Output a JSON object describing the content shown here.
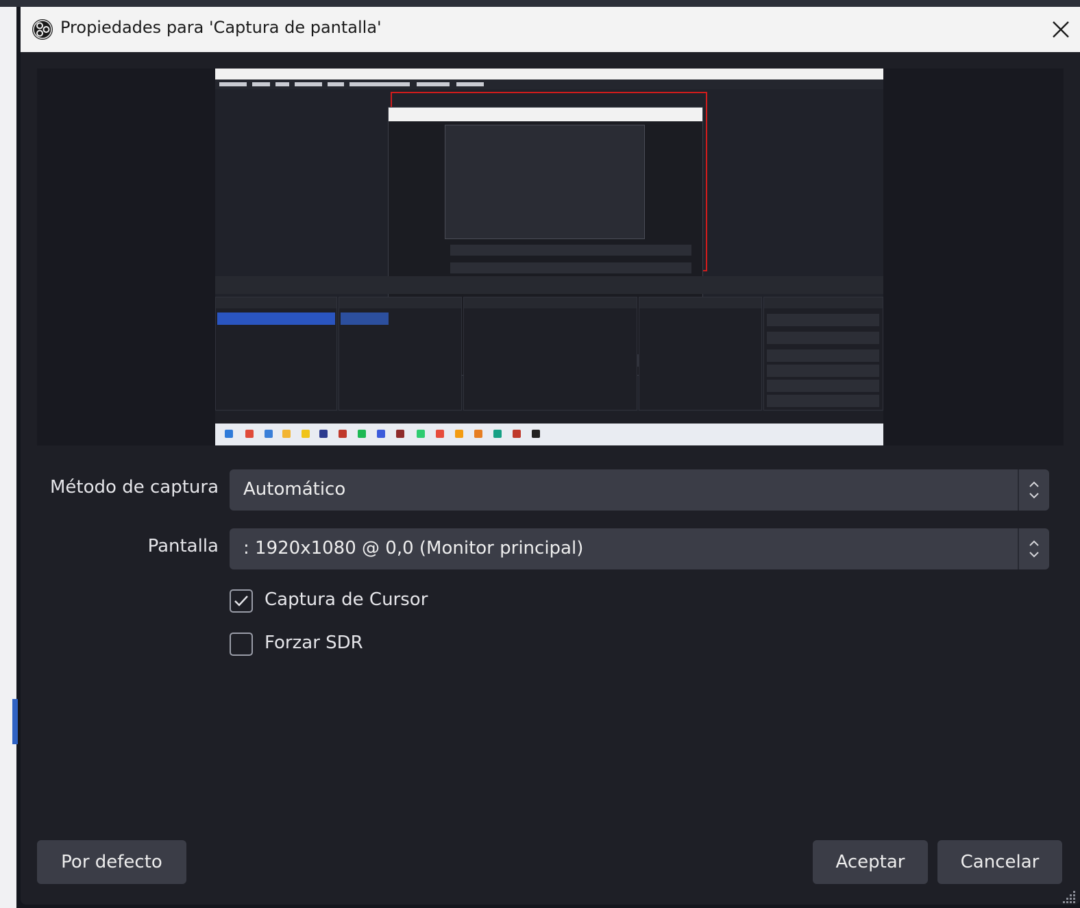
{
  "dialog": {
    "title": "Propiedades para 'Captura de pantalla'"
  },
  "form": {
    "capture_method": {
      "label": "Método de captura",
      "value": "Automático"
    },
    "display": {
      "label": "Pantalla",
      "value": ": 1920x1080 @ 0,0 (Monitor principal)"
    },
    "capture_cursor": {
      "label": "Captura de Cursor",
      "checked": true
    },
    "force_sdr": {
      "label": "Forzar SDR",
      "checked": false
    }
  },
  "buttons": {
    "defaults": "Por defecto",
    "accept": "Aceptar",
    "cancel": "Cancelar"
  },
  "colors": {
    "accent_blue": "#2a55c0",
    "preview_red": "#d01c1c"
  },
  "icons": {
    "app": "obs-logo-icon",
    "close": "close-icon",
    "combo_arrow": "chevron-up-down-icon",
    "check": "checkmark-icon"
  }
}
